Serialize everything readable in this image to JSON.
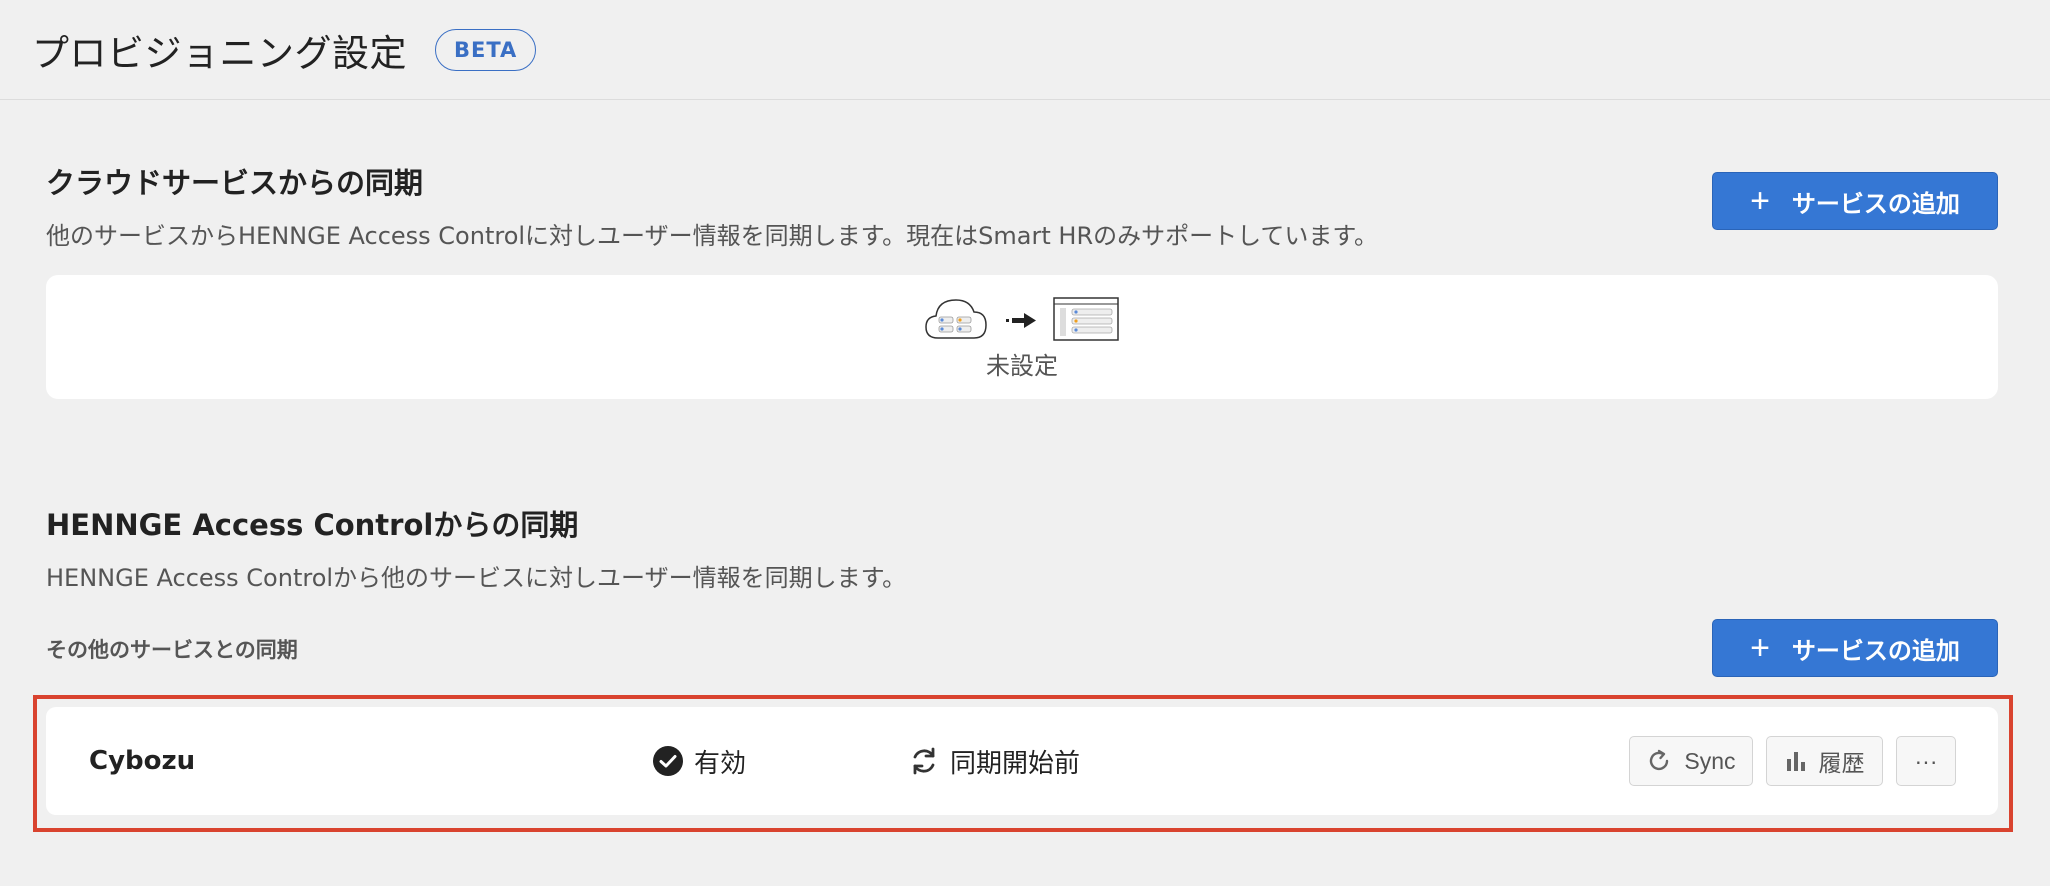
{
  "header": {
    "title": "プロビジョニング設定",
    "badge": "BETA"
  },
  "cloud_sync": {
    "title": "クラウドサービスからの同期",
    "description": "他のサービスからHENNGE Access Controlに対しユーザー情報を同期します。現在はSmart HRのみサポートしています。",
    "add_button": "サービスの追加",
    "empty_label": "未設定"
  },
  "hac_sync": {
    "title": "HENNGE Access Controlからの同期",
    "description": "HENNGE Access Controlから他のサービスに対しユーザー情報を同期します。",
    "sub_label": "その他のサービスとの同期",
    "add_button": "サービスの追加",
    "services": [
      {
        "name": "Cybozu",
        "status": "有効",
        "sync_status": "同期開始前",
        "sync_button": "Sync",
        "history_button": "履歴",
        "more_button": "···"
      }
    ]
  },
  "colors": {
    "primary": "#3577d4",
    "highlight": "#d9432f",
    "background": "#f0f0f0"
  }
}
